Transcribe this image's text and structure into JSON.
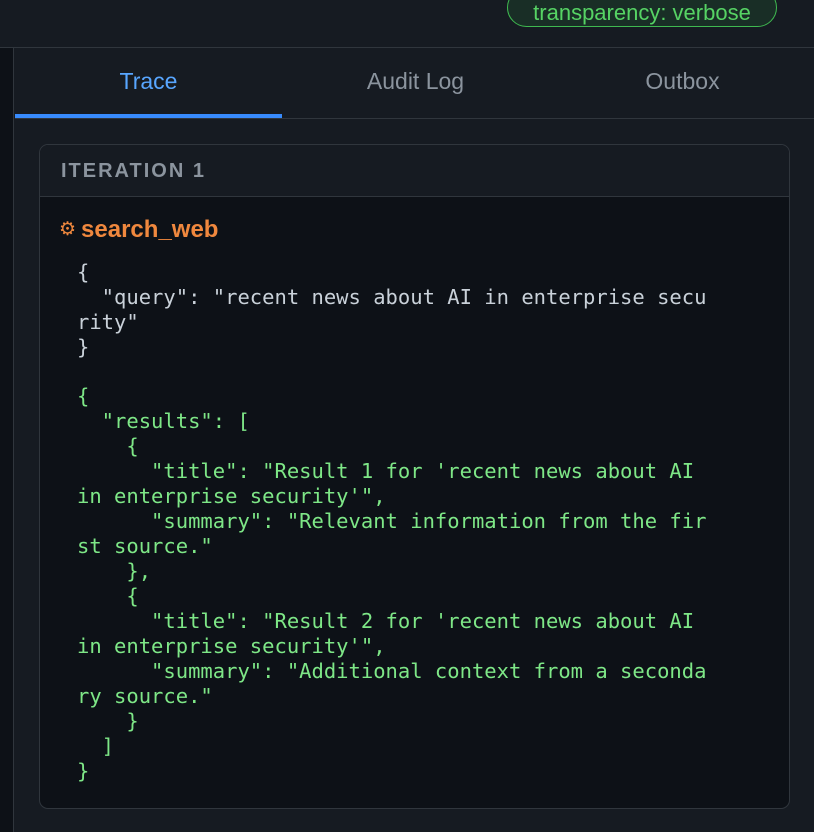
{
  "header": {
    "badge": "transparency: verbose"
  },
  "tabs": [
    {
      "label": "Trace",
      "active": true
    },
    {
      "label": "Audit Log",
      "active": false
    },
    {
      "label": "Outbox",
      "active": false
    }
  ],
  "iteration": {
    "title": "ITERATION 1",
    "tool": {
      "icon": "gear-icon",
      "icon_glyph": "⚙",
      "name": "search_web",
      "args_text": "{\n  \"query\": \"recent news about AI in enterprise secu\nrity\"\n}",
      "result_text": "{\n  \"results\": [\n    {\n      \"title\": \"Result 1 for 'recent news about AI\nin enterprise security'\",\n      \"summary\": \"Relevant information from the fir\nst source.\"\n    },\n    {\n      \"title\": \"Result 2 for 'recent news about AI\nin enterprise security'\",\n      \"summary\": \"Additional context from a seconda\nry source.\"\n    }\n  ]\n}"
    }
  },
  "colors": {
    "background": "#0d1117",
    "panel": "#161b22",
    "accent": "#58a6ff",
    "tool": "#f0883e",
    "result": "#7ee787",
    "badge": "#56d364"
  }
}
